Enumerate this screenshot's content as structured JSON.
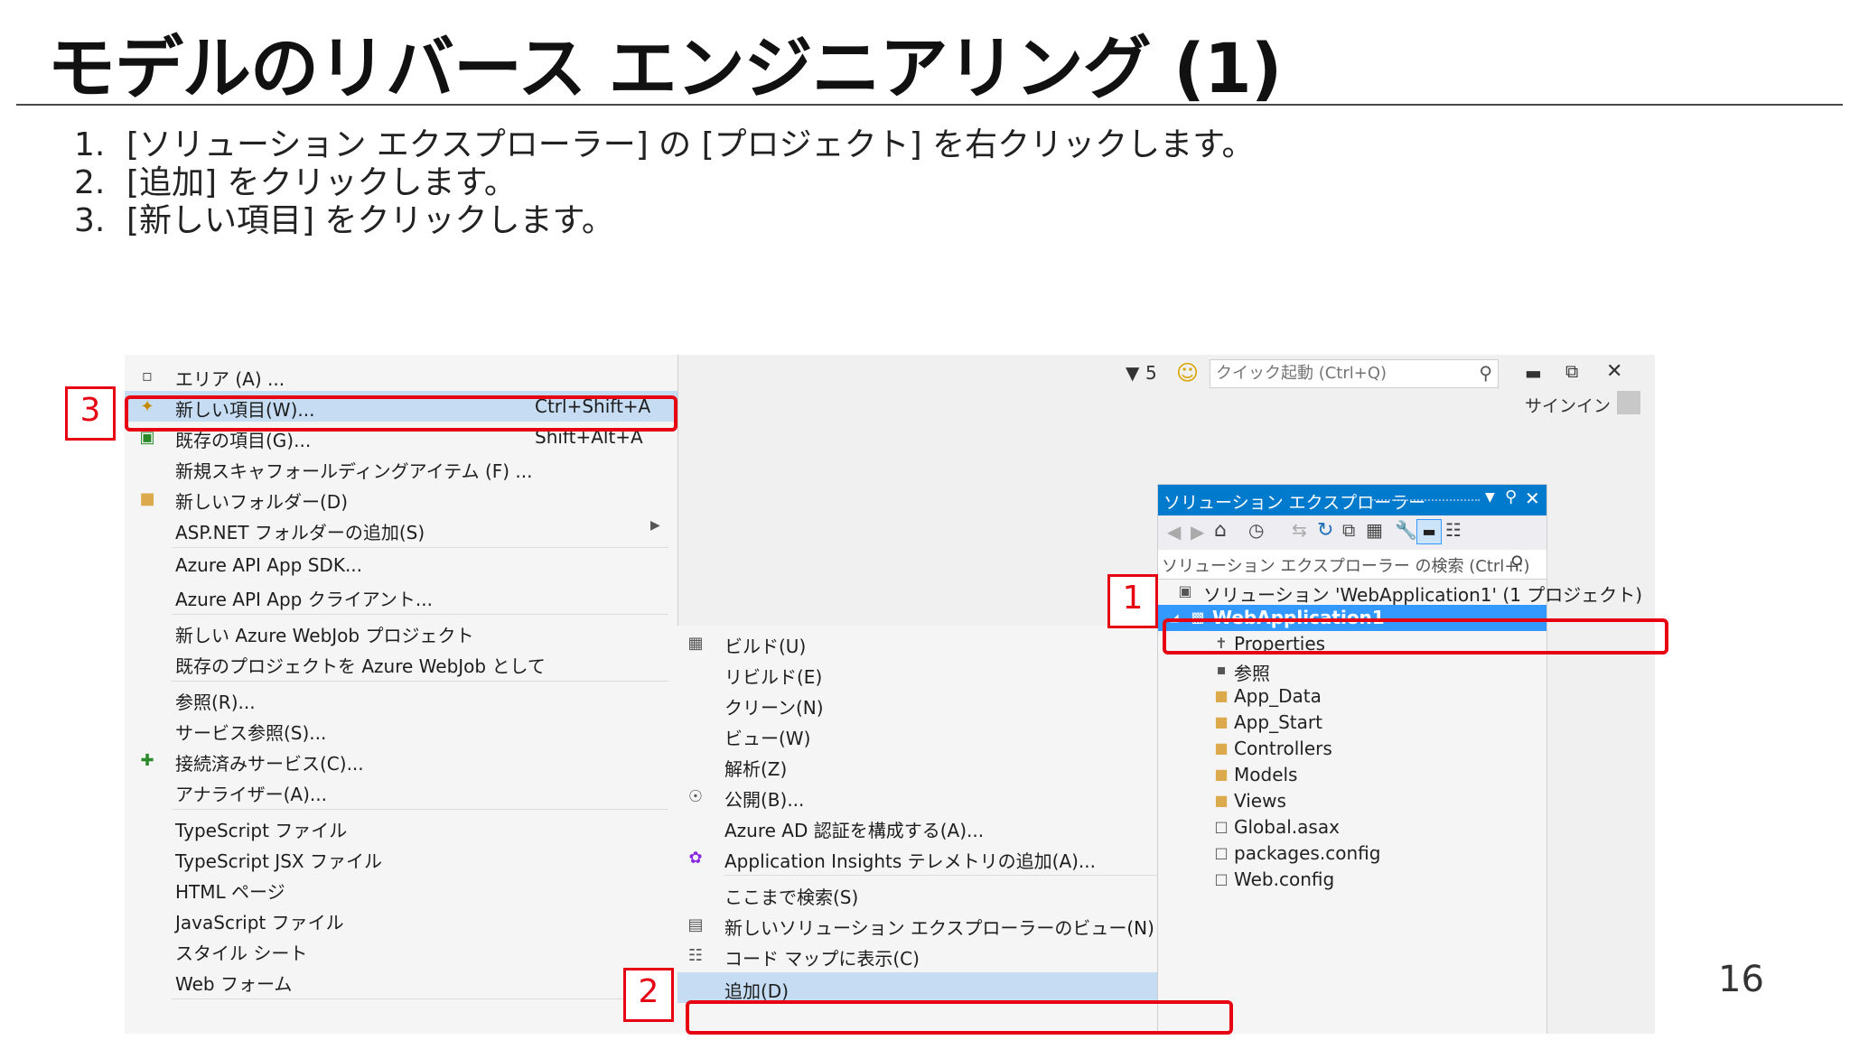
{
  "slide": {
    "title": "モデルのリバース エンジニアリング (1)",
    "steps": [
      {
        "num": "1.",
        "text": "[ソリューション エクスプローラー] の [プロジェクト] を右クリックします。"
      },
      {
        "num": "2.",
        "text": "[追加] をクリックします。"
      },
      {
        "num": "3.",
        "text": "[新しい項目] をクリックします。"
      }
    ],
    "page_number": "16"
  },
  "add_menu": {
    "items": [
      {
        "label": "エリア (A) ...",
        "shortcut": "",
        "icon": "area-icon"
      },
      {
        "label": "新しい項目(W)...",
        "shortcut": "Ctrl+Shift+A",
        "icon": "new-item-icon"
      },
      {
        "label": "既存の項目(G)...",
        "shortcut": "Shift+Alt+A",
        "icon": "existing-item-icon"
      },
      {
        "label": "新規スキャフォールディングアイテム (F) ...",
        "shortcut": "",
        "icon": ""
      },
      {
        "label": "新しいフォルダー(D)",
        "shortcut": "",
        "icon": "new-folder-icon"
      },
      {
        "label": "ASP.NET フォルダーの追加(S)",
        "shortcut": "",
        "icon": "",
        "submenu": true
      },
      {
        "label": "Azure API App SDK...",
        "shortcut": "",
        "icon": ""
      },
      {
        "label": "Azure API App クライアント...",
        "shortcut": "",
        "icon": ""
      },
      {
        "label": "新しい Azure WebJob プロジェクト",
        "shortcut": "",
        "icon": ""
      },
      {
        "label": "既存のプロジェクトを Azure WebJob として",
        "shortcut": "",
        "icon": ""
      },
      {
        "label": "参照(R)...",
        "shortcut": "",
        "icon": ""
      },
      {
        "label": "サービス参照(S)...",
        "shortcut": "",
        "icon": ""
      },
      {
        "label": "接続済みサービス(C)...",
        "shortcut": "",
        "icon": "connected-service-icon"
      },
      {
        "label": "アナライザー(A)...",
        "shortcut": "",
        "icon": ""
      },
      {
        "label": "TypeScript ファイル",
        "shortcut": "",
        "icon": ""
      },
      {
        "label": "TypeScript JSX ファイル",
        "shortcut": "",
        "icon": ""
      },
      {
        "label": "HTML ページ",
        "shortcut": "",
        "icon": ""
      },
      {
        "label": "JavaScript ファイル",
        "shortcut": "",
        "icon": ""
      },
      {
        "label": "スタイル シート",
        "shortcut": "",
        "icon": ""
      },
      {
        "label": "Web フォーム",
        "shortcut": "",
        "icon": ""
      }
    ]
  },
  "project_menu": {
    "items": [
      {
        "label": "ビルド(U)",
        "icon": "build-icon"
      },
      {
        "label": "リビルド(E)",
        "icon": ""
      },
      {
        "label": "クリーン(N)",
        "icon": ""
      },
      {
        "label": "ビュー(W)",
        "icon": "",
        "submenu": true
      },
      {
        "label": "解析(Z)",
        "icon": "",
        "submenu": true
      },
      {
        "label": "公開(B)...",
        "icon": "publish-icon"
      },
      {
        "label": "Azure AD 認証を構成する(A)...",
        "icon": ""
      },
      {
        "label": "Application Insights テレメトリの追加(A)...",
        "icon": "insights-icon"
      },
      {
        "label": "ここまで検索(S)",
        "icon": ""
      },
      {
        "label": "新しいソリューション エクスプローラーのビュー(N)",
        "icon": "new-view-icon"
      },
      {
        "label": "コード マップに表示(C)",
        "icon": "code-map-icon"
      },
      {
        "label": "追加(D)",
        "icon": "",
        "submenu": true
      }
    ]
  },
  "topbar": {
    "notification_count": "5",
    "quick_launch_placeholder": "クイック起動 (Ctrl+Q)",
    "signin": "サインイン"
  },
  "solution_explorer": {
    "title": "ソリューション エクスプローラー",
    "search_placeholder": "ソリューション エクスプローラー の検索 (Ctrl+:)",
    "tree": [
      {
        "label": "ソリューション 'WebApplication1' (1 プロジェクト)",
        "icon": "solution-icon",
        "level": 0
      },
      {
        "label": "WebApplication1",
        "icon": "project-icon",
        "level": 0,
        "selected": true
      },
      {
        "label": "Properties",
        "icon": "wrench-icon",
        "level": 1
      },
      {
        "label": "参照",
        "icon": "references-icon",
        "level": 1
      },
      {
        "label": "App_Data",
        "icon": "folder-icon",
        "level": 1
      },
      {
        "label": "App_Start",
        "icon": "folder-icon",
        "level": 1
      },
      {
        "label": "Controllers",
        "icon": "folder-icon",
        "level": 1
      },
      {
        "label": "Models",
        "icon": "folder-icon",
        "level": 1
      },
      {
        "label": "Views",
        "icon": "folder-icon",
        "level": 1
      },
      {
        "label": "Global.asax",
        "icon": "file-icon",
        "level": 1
      },
      {
        "label": "packages.config",
        "icon": "file-icon",
        "level": 1
      },
      {
        "label": "Web.config",
        "icon": "file-icon",
        "level": 1
      }
    ]
  },
  "callouts": [
    "1",
    "2",
    "3"
  ],
  "colors": {
    "highlight": "#c5dcf3",
    "selection": "#3399ff",
    "callout": "#e60012",
    "accent": "#007acc"
  }
}
